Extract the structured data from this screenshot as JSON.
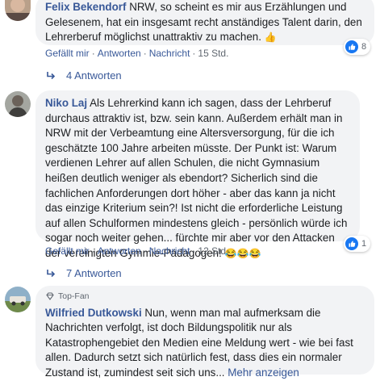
{
  "comments": [
    {
      "author": "Felix Bekendorf",
      "text": "NRW, so scheint es mir aus Erzählungen und Gelesenem, hat ein insgesamt recht anständiges Talent darin, den Lehrerberuf möglichst unattraktiv zu machen.",
      "emoji": "👍",
      "like_count": "8",
      "actions": {
        "like": "Gefällt mir",
        "reply": "Antworten",
        "message": "Nachricht",
        "time": "15 Std."
      },
      "replies_label": "4 Antworten"
    },
    {
      "author": "Niko Laj",
      "text": "Als Lehrerkind kann ich sagen, dass der Lehrberuf durchaus attraktiv ist, bzw. sein kann. Außerdem erhält man in NRW mit der Verbeamtung eine Altersversorgung, für die ich geschätzte 100 Jahre arbeiten müsste. Der Punkt ist: Warum verdienen Lehrer auf allen Schulen, die nicht Gymnasium heißen deutlich weniger als ebendort? Sicherlich sind die fachlichen Anforderungen dort höher - aber das kann ja nicht das einzige Kriterium sein?! Ist nicht die erforderliche Leistung auf allen Schulformen mindestens gleich - persönlich würde ich sogar noch weiter gehen... fürchte mir aber vor den Attacken der vereinigten Gymmie-Pädagogen!",
      "emoji": "😂😂😂",
      "like_count": "1",
      "actions": {
        "like": "Gefällt mir",
        "reply": "Antworten",
        "message": "Nachricht",
        "time": "12 Std."
      },
      "replies_label": "7 Antworten"
    },
    {
      "badge": "Top-Fan",
      "author": "Wilfried Dutkowski",
      "text": "Nun, wenn man mal aufmerksam die Nachrichten verfolgt, ist doch Bildungspolitik nur als Katastrophengebiet den Medien eine Meldung wert - wie bei fast allen. Dadurch setzt sich natürlich fest, dass dies ein normaler Zustand ist, zumindest seit sich uns...",
      "more": "Mehr anzeigen"
    }
  ],
  "colors": {
    "link": "#385898",
    "bubble": "#f2f3f5",
    "like_blue": "#1877f2",
    "meta": "#606770"
  }
}
